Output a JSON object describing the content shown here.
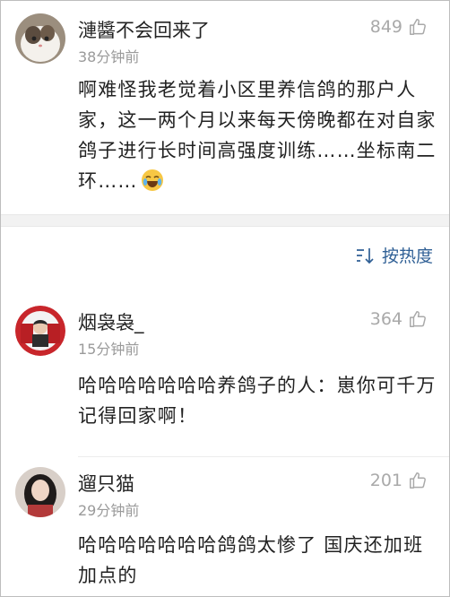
{
  "comments": [
    {
      "username": "漣醬不会回来了",
      "time": "38分钟前",
      "likes": "849",
      "body": "啊难怪我老觉着小区里养信鸽的那户人家，这一两个月以来每天傍晚都在对自家鸽子进行长时间高强度训练……坐标南二环……"
    },
    {
      "username": "烟袅袅_",
      "time": "15分钟前",
      "likes": "364",
      "body": "哈哈哈哈哈哈哈养鸽子的人：崽你可千万记得回家啊！"
    },
    {
      "username": "遛只猫",
      "time": "29分钟前",
      "likes": "201",
      "body": "哈哈哈哈哈哈哈鸽鸽太惨了 国庆还加班加点的"
    }
  ],
  "sort_label": "按热度",
  "colors": {
    "accent": "#2f5f95",
    "muted": "#9a9a9a",
    "separator": "#f2f2f2"
  }
}
